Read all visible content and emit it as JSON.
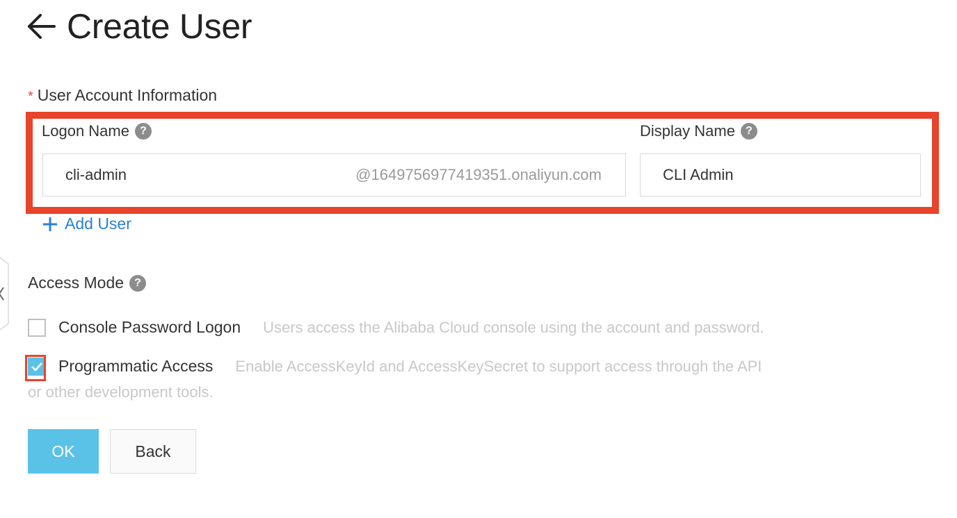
{
  "header": {
    "title": "Create User"
  },
  "user_account": {
    "section_label": "User Account Information",
    "required_marker": "*",
    "logon_name": {
      "label": "Logon Name",
      "value": "cli-admin",
      "suffix": "@1649756977419351.onaliyun.com"
    },
    "display_name": {
      "label": "Display Name",
      "value": "CLI Admin"
    },
    "help_glyph": "?",
    "add_user_label": "Add User",
    "add_user_icon": "plus-icon"
  },
  "access_mode": {
    "label": "Access Mode",
    "options": [
      {
        "label": "Console Password Logon",
        "description": "Users access the Alibaba Cloud console using the account and password.",
        "checked": false
      },
      {
        "label": "Programmatic Access",
        "description": "Enable AccessKeyId and AccessKeySecret to support access through the API",
        "description_continued": "or other development tools.",
        "checked": true
      }
    ]
  },
  "buttons": {
    "ok": "OK",
    "back": "Back"
  },
  "colors": {
    "accent": "#5bc2e7",
    "highlight": "#e8432b",
    "link": "#2a7fd4"
  }
}
